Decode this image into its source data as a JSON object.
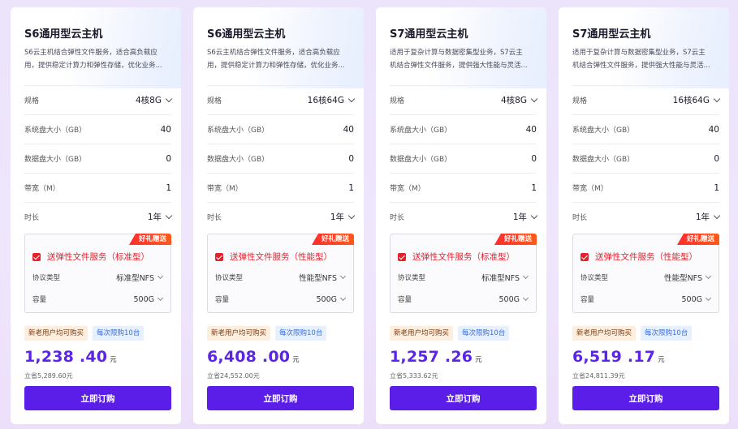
{
  "labels": {
    "spec": "规格",
    "system_disk": "系统盘大小（GB）",
    "data_disk": "数据盘大小（GB）",
    "bandwidth": "带宽（M）",
    "duration": "时长",
    "gift_badge": "好礼赠送",
    "protocol": "协议类型",
    "capacity": "容量",
    "tag_new": "新老用户均可购买",
    "tag_limit": "每次限购10台",
    "price_unit": "元",
    "buy_button": "立即订购"
  },
  "colors": {
    "accent": "#5b1ee8",
    "price": "#5b24e6",
    "gift_red": "#e3222d"
  },
  "cards": [
    {
      "title": "S6通用型云主机",
      "desc_line1": "S6云主机结合弹性文件服务，适合高负载应",
      "desc_line2": "用，提供稳定计算力和弹性存储，优化业务...",
      "spec": "4核8G",
      "system_disk": "40",
      "data_disk": "0",
      "bandwidth": "1",
      "duration": "1年",
      "gift_title": "送弹性文件服务（标准型）",
      "protocol": "标准型NFS",
      "capacity": "500G",
      "price": "1,238 .40",
      "save": "立省5,289.60元"
    },
    {
      "title": "S6通用型云主机",
      "desc_line1": "S6云主机结合弹性文件服务，适合高负载应",
      "desc_line2": "用，提供稳定计算力和弹性存储，优化业务...",
      "spec": "16核64G",
      "system_disk": "40",
      "data_disk": "0",
      "bandwidth": "1",
      "duration": "1年",
      "gift_title": "送弹性文件服务（性能型）",
      "protocol": "性能型NFS",
      "capacity": "500G",
      "price": "6,408 .00",
      "save": "立省24,552.00元"
    },
    {
      "title": "S7通用型云主机",
      "desc_line1": "适用于复杂计算与数据密集型业务，S7云主",
      "desc_line2": "机结合弹性文件服务，提供强大性能与灵活...",
      "spec": "4核8G",
      "system_disk": "40",
      "data_disk": "0",
      "bandwidth": "1",
      "duration": "1年",
      "gift_title": "送弹性文件服务（标准型）",
      "protocol": "标准型NFS",
      "capacity": "500G",
      "price": "1,257 .26",
      "save": "立省5,333.62元"
    },
    {
      "title": "S7通用型云主机",
      "desc_line1": "适用于复杂计算与数据密集型业务，S7云主",
      "desc_line2": "机结合弹性文件服务，提供强大性能与灵活...",
      "spec": "16核64G",
      "system_disk": "40",
      "data_disk": "0",
      "bandwidth": "1",
      "duration": "1年",
      "gift_title": "送弹性文件服务（性能型）",
      "protocol": "性能型NFS",
      "capacity": "500G",
      "price": "6,519 .17",
      "save": "立省24,811.39元"
    }
  ]
}
